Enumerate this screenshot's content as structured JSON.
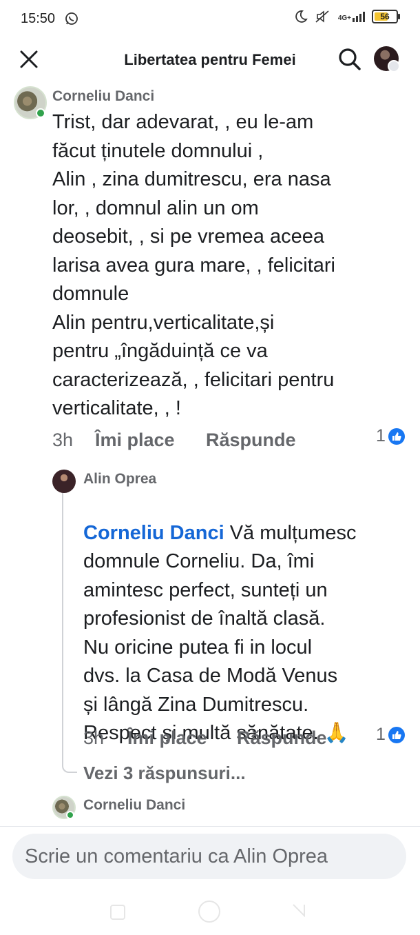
{
  "status_bar": {
    "time": "15:50",
    "network": "4G+",
    "battery": "56"
  },
  "header": {
    "title": "Libertatea pentru Femei"
  },
  "comments": [
    {
      "author": "Corneliu Danci",
      "text": "Trist, dar adevarat, , eu le-am\nfăcut ținutele  domnului ,\nAlin , zina dumitrescu, era nasa\nlor, , domnul alin  un om\ndeosebit,  , si pe vremea aceea\nlarisa avea gura mare, , felicitari\ndomnule\nAlin pentru,verticalitate,și\npentru „îngăduință ce va\ncaracterizează, , felicitari pentru\nverticalitate,  , !",
      "time": "3h",
      "like_label": "Îmi place",
      "reply_label": "Răspunde",
      "reactions": "1"
    }
  ],
  "reply": {
    "author": "Alin Oprea",
    "mention": "Corneliu Danci",
    "text_first": " Vă mulțumesc",
    "text_rest": "domnule Corneliu. Da, îmi\namintesc perfect, sunteți un\nprofesionist de înaltă clasă.\nNu oricine putea fi in locul\ndvs. la Casa de Modă Venus\nși lângă Zina Dumitrescu.\nRespect și multă sănătate. 🙏",
    "time": "3h",
    "like_label": "Îmi place",
    "reply_label": "Răspunde",
    "reactions": "1"
  },
  "see_replies": "Vezi 3 răspunsuri...",
  "next_comment": {
    "author": "Corneliu Danci"
  },
  "composer": {
    "placeholder": "Scrie un comentariu ca Alin Oprea"
  },
  "colors": {
    "mention": "#1567d6",
    "like_blue": "#1877f2",
    "meta_gray": "#65676b"
  }
}
